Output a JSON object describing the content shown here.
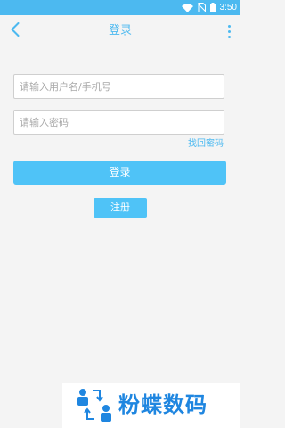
{
  "status_bar": {
    "time": "3:50",
    "icons": [
      "wifi-icon",
      "no-sim-icon",
      "battery-icon"
    ]
  },
  "header": {
    "title": "登录",
    "back_icon": "chevron-left-icon",
    "more_icon": "more-vertical-icon"
  },
  "form": {
    "username_placeholder": "请输入用户名/手机号",
    "username_value": "",
    "password_placeholder": "请输入密码",
    "password_value": "",
    "forgot_password_label": "找回密码",
    "login_label": "登录",
    "register_label": "注册"
  },
  "watermark": {
    "text": "粉蝶数码"
  },
  "colors": {
    "accent": "#4cb9f0",
    "button": "#4fc3f7",
    "background": "#f4f4f4",
    "watermark_text": "#1f86e0"
  }
}
